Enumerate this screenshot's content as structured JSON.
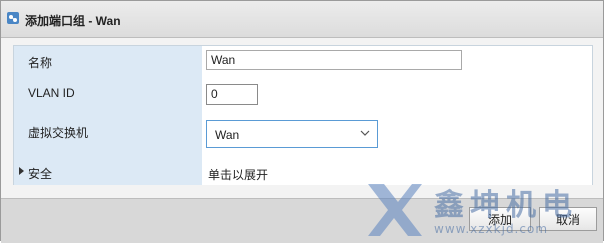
{
  "dialog": {
    "title": "添加端口组 - Wan",
    "icon": "port-group-icon"
  },
  "form": {
    "name_label": "名称",
    "name_value": "Wan",
    "vlan_label": "VLAN ID",
    "vlan_value": "0",
    "vswitch_label": "虚拟交换机",
    "vswitch_value": "Wan",
    "security_label": "安全",
    "security_hint": "单击以展开"
  },
  "footer": {
    "add_label": "添加",
    "cancel_label": "取消"
  },
  "watermark": {
    "brand": "鑫坤机电",
    "url": "www.xzxkjd.com"
  },
  "colors": {
    "label_bg": "#dce9f5",
    "focus_border": "#5a9bd5",
    "watermark": "#4a6fa5"
  }
}
